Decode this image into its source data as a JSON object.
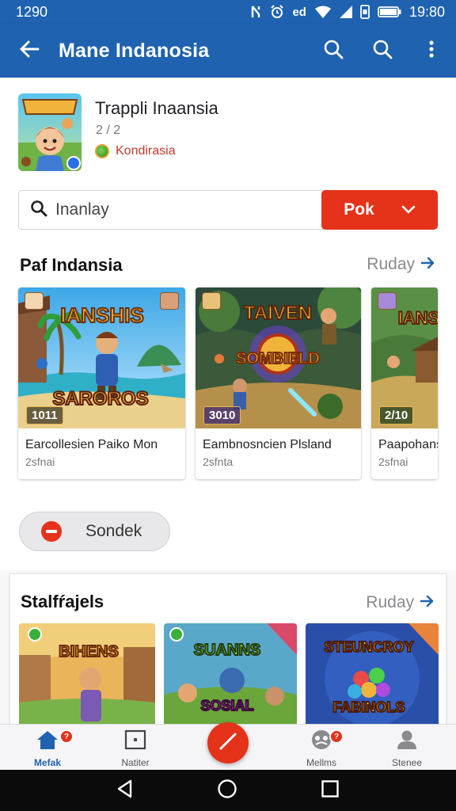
{
  "status_bar": {
    "left_time": "1290",
    "network": "ed",
    "right_time": "19:80"
  },
  "app_bar": {
    "title": "Mane Indanosia",
    "icons": [
      "back-arrow-icon",
      "search-icon",
      "search-icon",
      "more-vert-icon"
    ]
  },
  "app_header": {
    "name": "Trappli Inaansia",
    "version": "2 / 2",
    "tag": "Kondirasia"
  },
  "search": {
    "value": "Inanlay",
    "button_label": "Pok"
  },
  "section1": {
    "title": "Paf Indansia",
    "link_label": "Ruday",
    "cards": [
      {
        "art_title": "IANSHIS",
        "art_subtitle": "SAROROS",
        "price": "1011",
        "title": "Earcollesien Paiko Mon",
        "subtitle": "2sfnai"
      },
      {
        "art_title": "TAIVEN",
        "art_subtitle": "SOMBIELD",
        "price": "3010",
        "title": "Eambnosncien Plsland",
        "subtitle": "2sfnta"
      },
      {
        "art_title": "IANS",
        "art_subtitle": "",
        "price": "2/10",
        "title": "Paapohans",
        "subtitle": "2sfnai"
      }
    ]
  },
  "pill": {
    "label": "Sondek"
  },
  "section2": {
    "title": "Stalfŕajels",
    "link_label": "Ruday",
    "cards": [
      {
        "art_title": "BIHENS"
      },
      {
        "art_title": "SUANNS",
        "art_subtitle": "SOSIAL"
      },
      {
        "art_title": "STEUNCROY",
        "art_subtitle": "FABINOLS"
      }
    ]
  },
  "bottom_nav": {
    "items": [
      {
        "label": "Mefak",
        "icon": "home-icon",
        "badge": "?"
      },
      {
        "label": "Natiter",
        "icon": "square-icon"
      },
      {
        "label": "Mellms",
        "icon": "avatar-group-icon",
        "badge": "?"
      },
      {
        "label": "Stenee",
        "icon": "person-icon"
      }
    ]
  },
  "colors": {
    "primary": "#1e62b0",
    "accent": "#e5321a",
    "background": "#f7f7f8"
  }
}
